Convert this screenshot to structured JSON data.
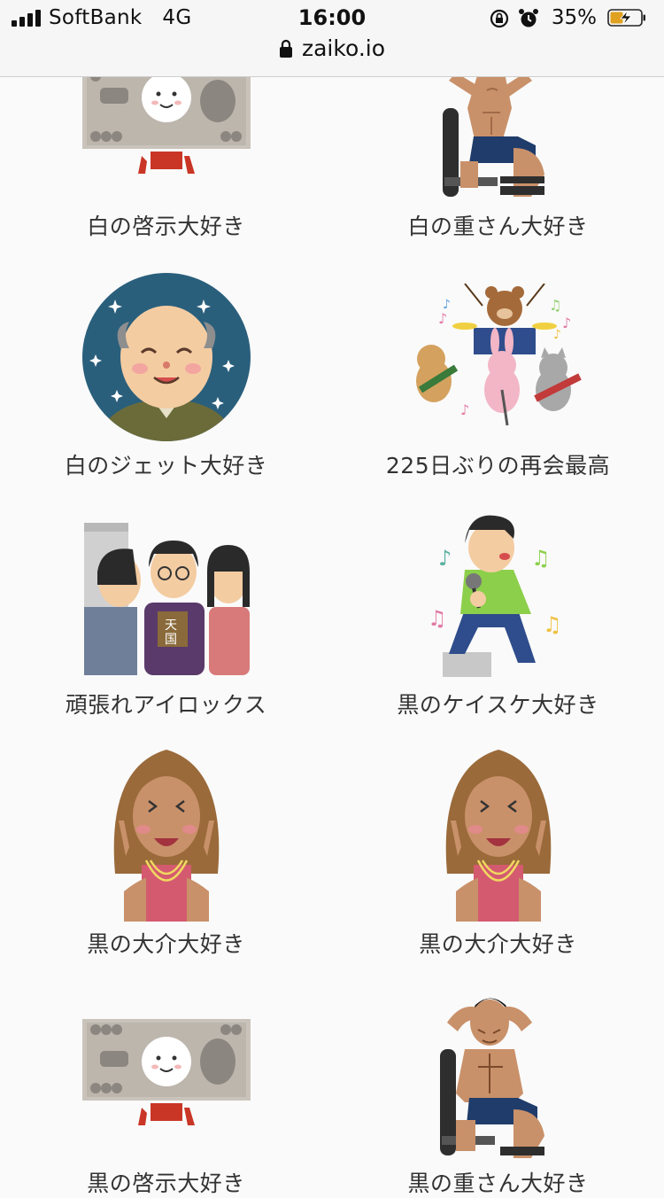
{
  "status_bar": {
    "carrier": "SoftBank",
    "network": "4G",
    "time": "16:00",
    "battery_percent": "35%",
    "icons": [
      "signal-icon",
      "rotation-lock-icon",
      "alarm-icon",
      "battery-charging-icon"
    ]
  },
  "browser": {
    "url": "zaiko.io",
    "icon": "lock-icon"
  },
  "items": [
    {
      "label": "白の啓示大好き",
      "image": "banknote-illustration"
    },
    {
      "label": "白の重さん大好き",
      "image": "bodybuilder-bench-illustration"
    },
    {
      "label": "白のジェット大好き",
      "image": "grandpa-portrait-illustration"
    },
    {
      "label": "225日ぶりの再会最高",
      "image": "animal-band-illustration"
    },
    {
      "label": "頑張れアイロックス",
      "image": "door-visitors-illustration"
    },
    {
      "label": "黒のケイスケ大好き",
      "image": "karaoke-singer-illustration"
    },
    {
      "label": "黒の大介大好き",
      "image": "gyaru-peace-illustration"
    },
    {
      "label": "黒の大介大好き",
      "image": "gyaru-peace-illustration"
    },
    {
      "label": "黒の啓示大好き",
      "image": "banknote-illustration"
    },
    {
      "label": "黒の重さん大好き",
      "image": "bodybuilder-bench-illustration"
    }
  ]
}
